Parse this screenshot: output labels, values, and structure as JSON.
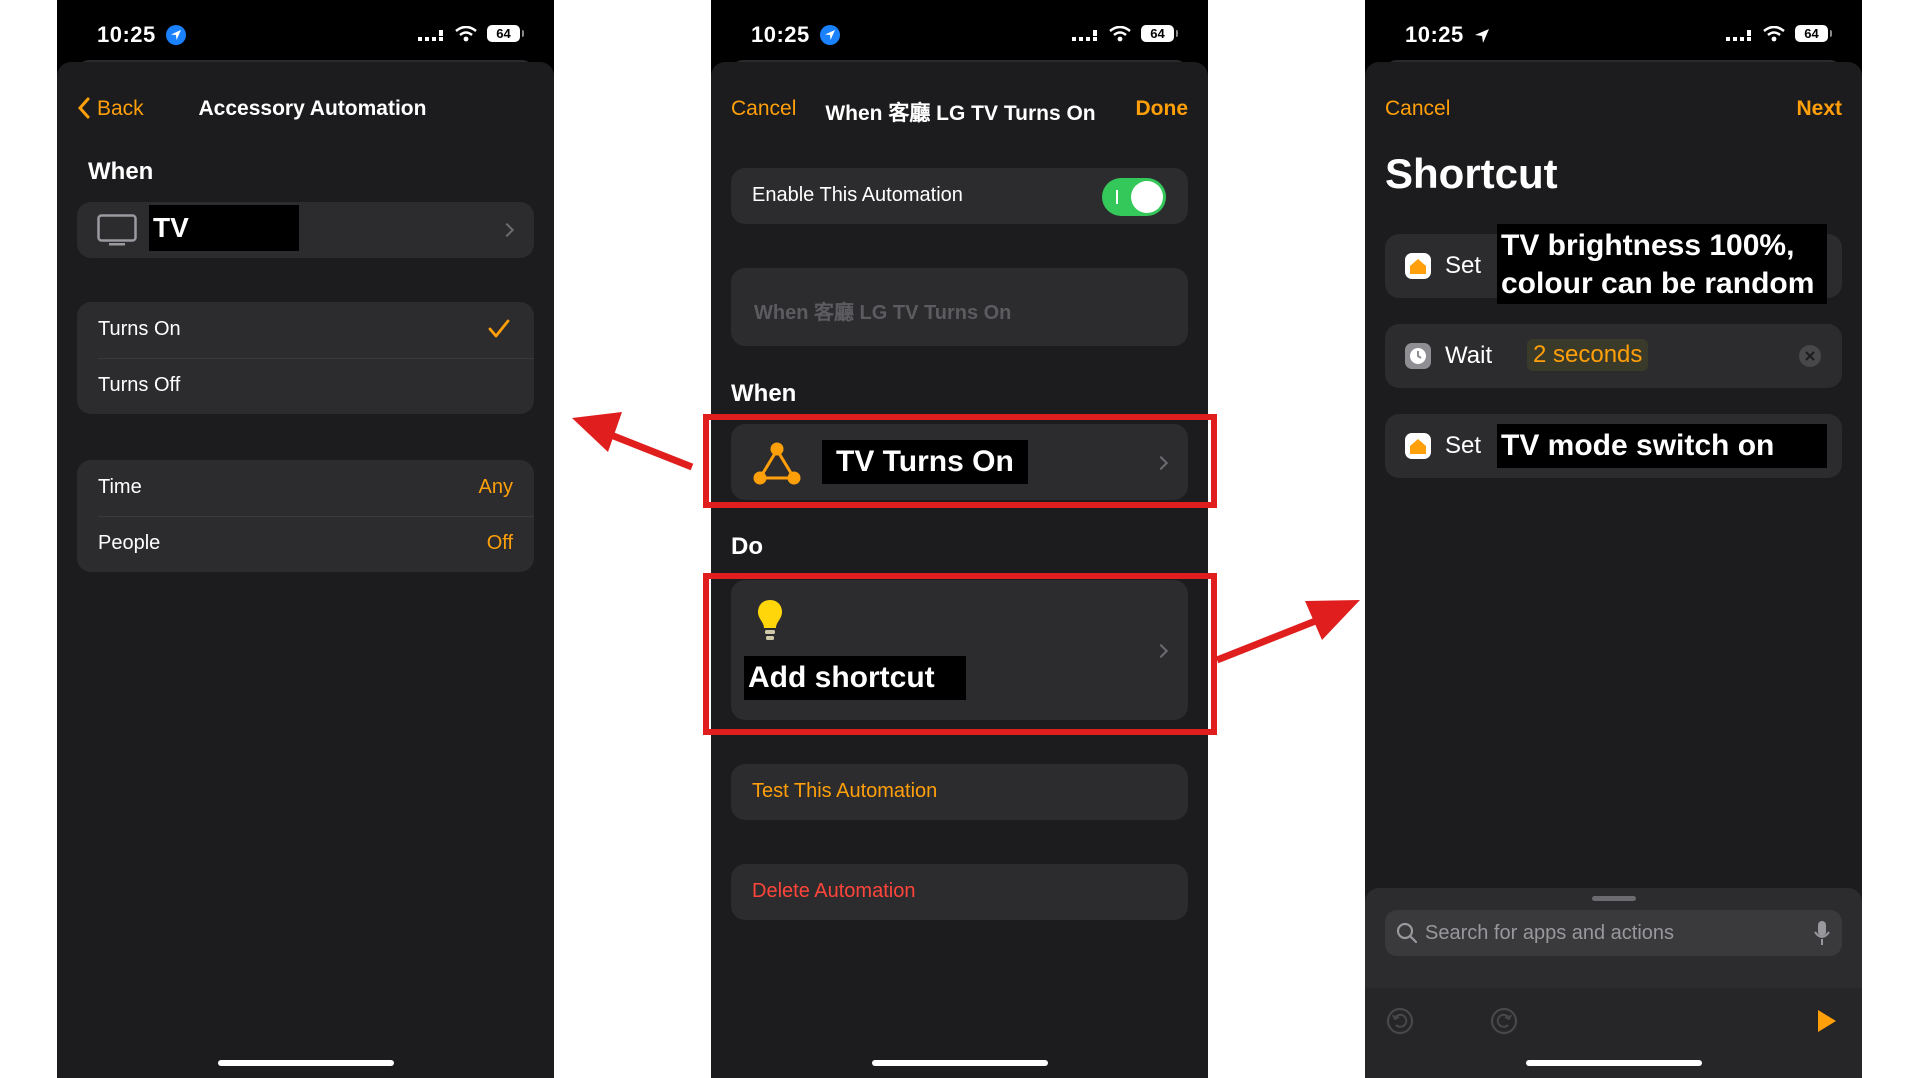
{
  "status": {
    "time": "10:25",
    "battery": "64"
  },
  "screen1": {
    "back_label": "Back",
    "title": "Accessory Automation",
    "when_title": "When",
    "accessory_name": "TV",
    "options": [
      {
        "label": "Turns On",
        "checked": true
      },
      {
        "label": "Turns Off",
        "checked": false
      }
    ],
    "conditions": [
      {
        "label": "Time",
        "value": "Any"
      },
      {
        "label": "People",
        "value": "Off"
      }
    ]
  },
  "screen2": {
    "cancel_label": "Cancel",
    "title": "When 客廳 LG TV Turns On",
    "done_label": "Done",
    "enable_label": "Enable This Automation",
    "enabled": true,
    "name_field_placeholder": "When 客廳 LG TV Turns On",
    "when_title": "When",
    "trigger_label": "TV Turns On",
    "do_title": "Do",
    "action_label": "Add shortcut",
    "test_label": "Test This Automation",
    "delete_label": "Delete Automation"
  },
  "screen3": {
    "cancel_label": "Cancel",
    "next_label": "Next",
    "title": "Shortcut",
    "actions": [
      {
        "verb": "Set",
        "label": "TV brightness 100%, colour can be random"
      },
      {
        "verb": "Wait",
        "token": "2 seconds"
      },
      {
        "verb": "Set",
        "label": "TV mode switch on"
      }
    ],
    "search_placeholder": "Search for apps and actions"
  },
  "colors": {
    "accent": "#ff9f0a",
    "destructive": "#ff453a",
    "toggle_on": "#34c759",
    "annotation": "#e01e1e"
  }
}
